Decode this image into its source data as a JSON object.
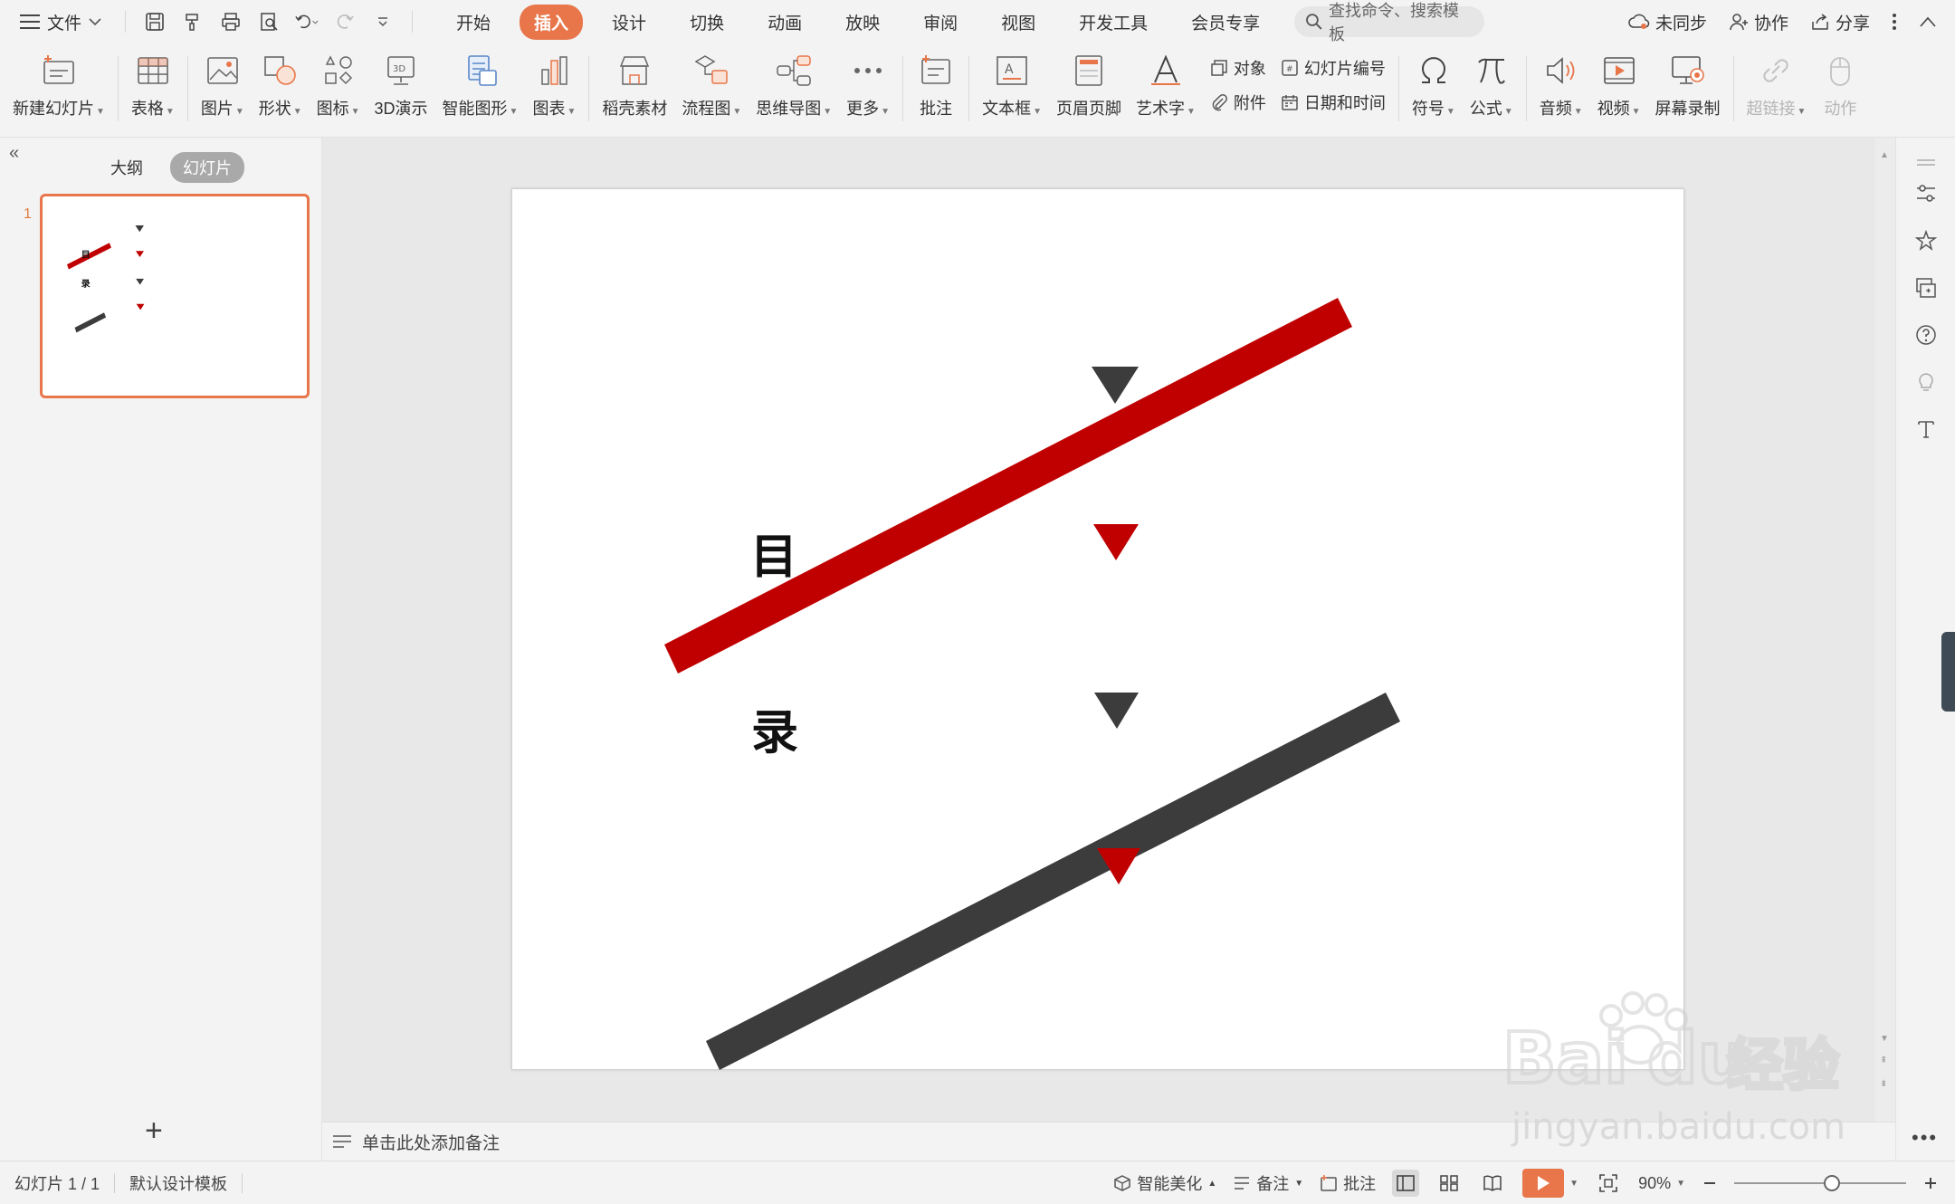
{
  "menu": {
    "file_label": "文件",
    "tabs": [
      "开始",
      "插入",
      "设计",
      "切换",
      "动画",
      "放映",
      "审阅",
      "视图",
      "开发工具",
      "会员专享"
    ],
    "active_tab": "插入",
    "search_placeholder": "查找命令、搜索模板",
    "right": {
      "sync": "未同步",
      "collab": "协作",
      "share": "分享"
    }
  },
  "ribbon": {
    "new_slide": "新建幻灯片",
    "table": "表格",
    "picture": "图片",
    "shape": "形状",
    "icon": "图标",
    "three_d": "3D演示",
    "smart_graphic": "智能图形",
    "chart": "图表",
    "material": "稻壳素材",
    "flowchart": "流程图",
    "mindmap": "思维导图",
    "more": "更多",
    "comment": "批注",
    "textbox": "文本框",
    "header_footer": "页眉页脚",
    "wordart": "艺术字",
    "object": "对象",
    "attachment": "附件",
    "slide_number": "幻灯片编号",
    "datetime": "日期和时间",
    "symbol": "符号",
    "formula": "公式",
    "audio": "音频",
    "video": "视频",
    "screen_record": "屏幕录制",
    "hyperlink": "超链接",
    "action": "动作"
  },
  "left_panel": {
    "tab_outline": "大纲",
    "tab_slides": "幻灯片",
    "slide_number": "1"
  },
  "slide": {
    "char_top": "目",
    "char_bottom": "录",
    "colors": {
      "red": "#c00000",
      "dark": "#3c3c3c"
    }
  },
  "notes_placeholder": "单击此处添加备注",
  "status": {
    "slide_info": "幻灯片 1 / 1",
    "template": "默认设计模板",
    "beautify": "智能美化",
    "notes": "备注",
    "comments": "批注",
    "zoom": "90%",
    "zoom_fraction": 0.57
  },
  "watermark": {
    "brand": "Bai",
    "brand2": "du",
    "cn": "经验",
    "url": "jingyan.baidu.com"
  },
  "accent_color": "#e8764a"
}
